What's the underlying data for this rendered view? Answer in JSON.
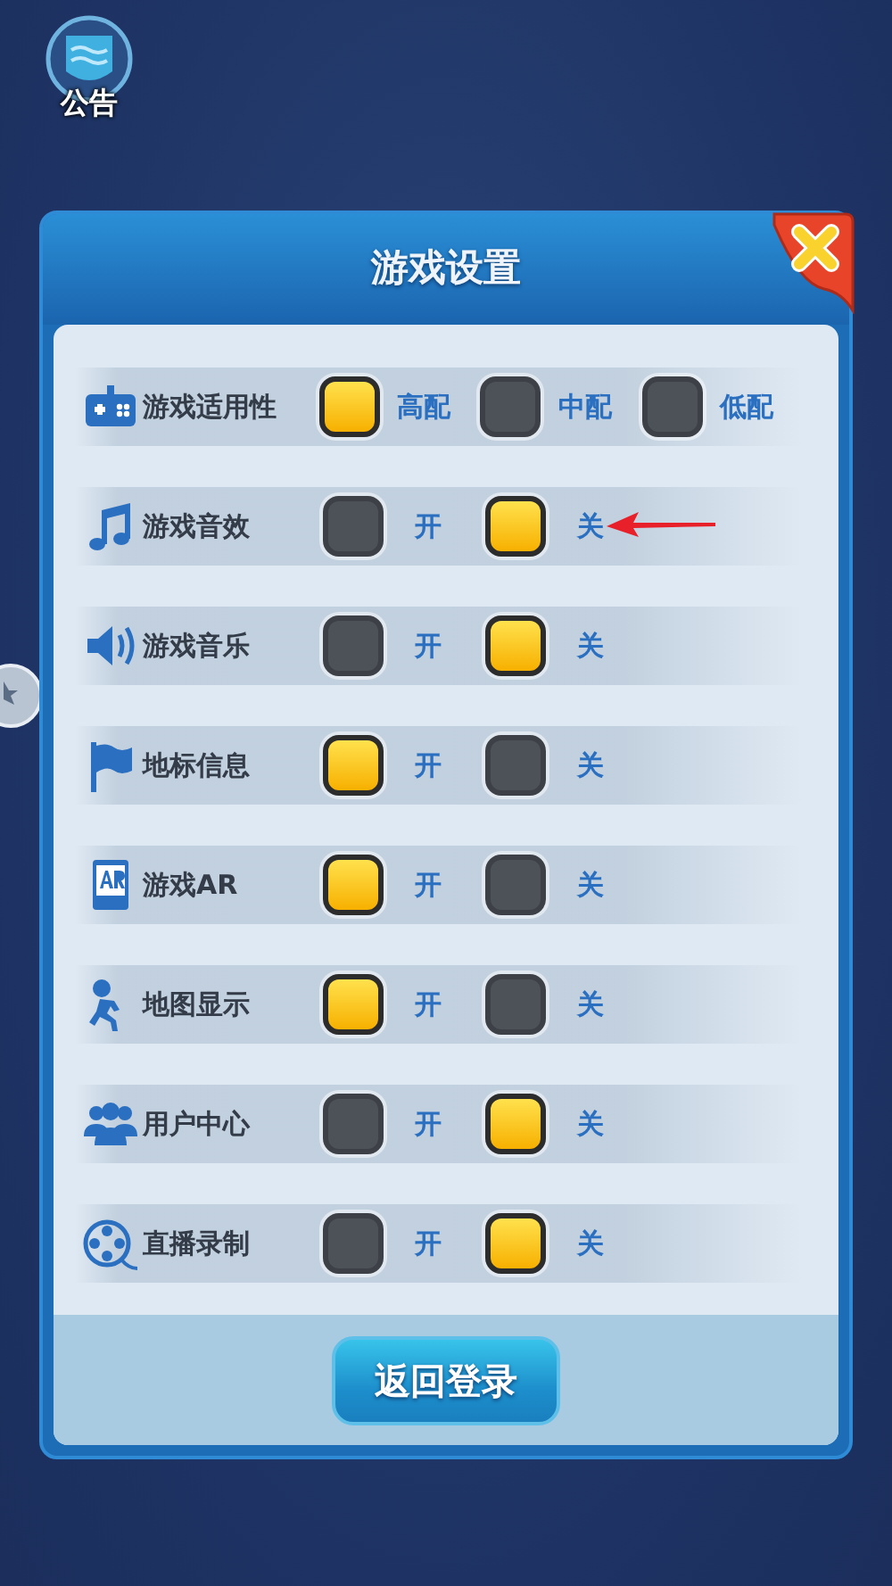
{
  "notice": {
    "label": "公告"
  },
  "dialog": {
    "title": "游戏设置",
    "settings": [
      {
        "kind": "gamepad",
        "label": "游戏适用性",
        "options": [
          {
            "label": "高配",
            "selected": true
          },
          {
            "label": "中配",
            "selected": false
          },
          {
            "label": "低配",
            "selected": false
          }
        ]
      },
      {
        "kind": "music",
        "label": "游戏音效",
        "options": [
          {
            "label": "开",
            "selected": false
          },
          {
            "label": "关",
            "selected": true
          }
        ]
      },
      {
        "kind": "speaker",
        "label": "游戏音乐",
        "options": [
          {
            "label": "开",
            "selected": false
          },
          {
            "label": "关",
            "selected": true
          }
        ]
      },
      {
        "kind": "flag",
        "label": "地标信息",
        "options": [
          {
            "label": "开",
            "selected": true
          },
          {
            "label": "关",
            "selected": false
          }
        ]
      },
      {
        "kind": "ar",
        "label": "游戏AR",
        "options": [
          {
            "label": "开",
            "selected": true
          },
          {
            "label": "关",
            "selected": false
          }
        ]
      },
      {
        "kind": "runner",
        "label": "地图显示",
        "options": [
          {
            "label": "开",
            "selected": true
          },
          {
            "label": "关",
            "selected": false
          }
        ]
      },
      {
        "kind": "people",
        "label": "用户中心",
        "options": [
          {
            "label": "开",
            "selected": false
          },
          {
            "label": "关",
            "selected": true
          }
        ]
      },
      {
        "kind": "reel",
        "label": "直播录制",
        "options": [
          {
            "label": "开",
            "selected": false
          },
          {
            "label": "关",
            "selected": true
          }
        ]
      }
    ],
    "button": "返回登录"
  }
}
